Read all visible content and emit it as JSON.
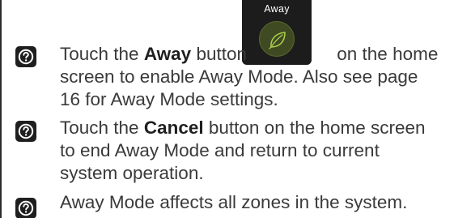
{
  "away_button": {
    "label": "Away",
    "icon": "leaf-icon",
    "accent_color": "#a8cc4a"
  },
  "notes": [
    {
      "icon": "help-icon",
      "lines": [
        {
          "pre": "Touch the ",
          "bold": "Away",
          "post": " button",
          "after_button": " on the home"
        },
        {
          "text": "screen to enable Away Mode. Also see page"
        },
        {
          "text": "16 for Away Mode settings."
        }
      ]
    },
    {
      "icon": "help-icon",
      "lines": [
        {
          "pre": "Touch the ",
          "bold": "Cancel",
          "post": " button on the home screen"
        },
        {
          "text": "to end Away Mode and return to current"
        },
        {
          "text": "system operation."
        }
      ]
    },
    {
      "icon": "help-icon",
      "lines": [
        {
          "text": "Away Mode affects all zones in the system."
        }
      ]
    }
  ]
}
